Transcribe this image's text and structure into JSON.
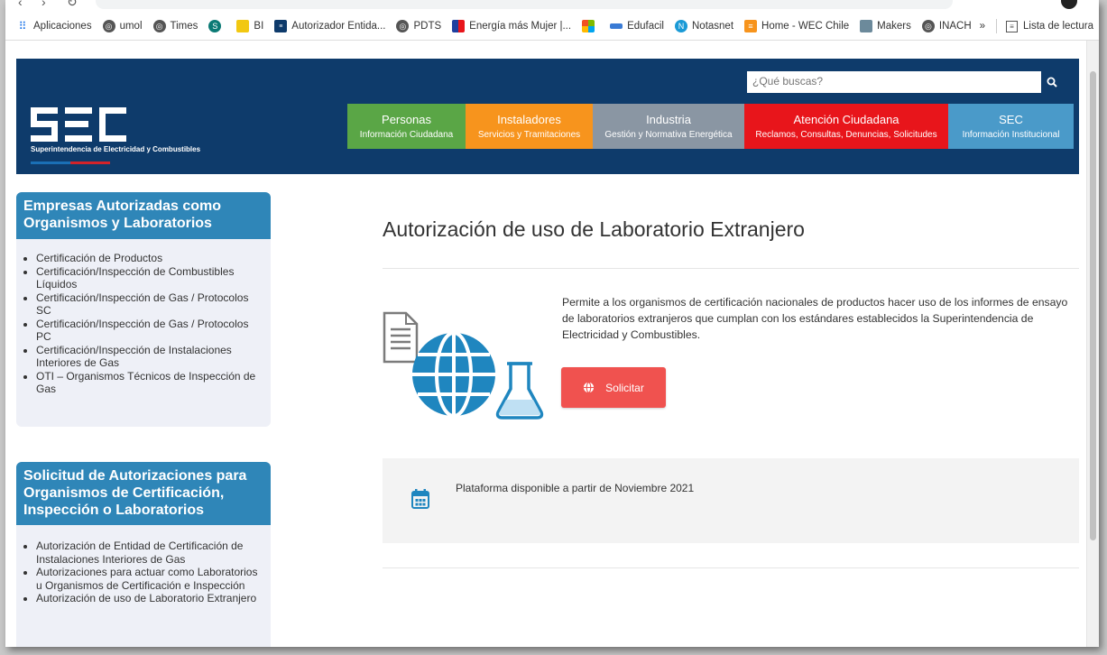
{
  "bookmarks": {
    "apps": "Aplicaciones",
    "items": [
      "umol",
      "Times",
      "BI",
      "Autorizador Entida...",
      "PDTS",
      "Energía más Mujer |...",
      "Edufacil",
      "Notasnet",
      "Home - WEC Chile",
      "Makers",
      "INACH"
    ],
    "more": "»",
    "reading_list": "Lista de lectura"
  },
  "header": {
    "logo_text": "SEC",
    "logo_subtitle": "Superintendencia de Electricidad y Combustibles",
    "search_placeholder": "¿Qué buscas?"
  },
  "menu": [
    {
      "title": "Personas",
      "subtitle": "Información Ciudadana",
      "color": "#5aa646"
    },
    {
      "title": "Instaladores",
      "subtitle": "Servicios y Tramitaciones",
      "color": "#f7941d"
    },
    {
      "title": "Industria",
      "subtitle": "Gestión y Normativa Energética",
      "color": "#8a96a3"
    },
    {
      "title": "Atención Ciudadana",
      "subtitle": "Reclamos, Consultas, Denuncias, Solicitudes",
      "color": "#e8151b"
    },
    {
      "title": "SEC",
      "subtitle": "Información Institucional",
      "color": "#4a9ac9"
    }
  ],
  "sidebar1": {
    "title": "Empresas Autorizadas como Organismos y Laboratorios",
    "items": [
      "Certificación de Productos",
      "Certificación/Inspección de Combustibles Líquidos",
      "Certificación/Inspección de Gas / Protocolos SC",
      "Certificación/Inspección de Gas / Protocolos PC",
      "Certificación/Inspección de Instalaciones Interiores de Gas",
      "OTI – Organismos Técnicos de Inspección de Gas"
    ]
  },
  "sidebar2": {
    "title": "Solicitud de Autorizaciones para Organismos de Certificación, Inspección o Laboratorios",
    "items": [
      "Autorización de Entidad de Certificación de Instalaciones Interiores de Gas",
      "Autorizaciones para actuar como Laboratorios u Organismos de Certificación e Inspección",
      "Autorización de uso de Laboratorio Extranjero"
    ]
  },
  "main": {
    "title": "Autorización de uso de Laboratorio Extranjero",
    "description": "Permite a los organismos de certificación nacionales de productos hacer uso de los informes de ensayo de laboratorios extranjeros que cumplan con los estándares establecidos la Superintendencia de Electricidad y Combustibles.",
    "button_label": "Solicitar",
    "availability": "Plataforma disponible a partir de  Noviembre 2021"
  },
  "colors": {
    "header_bg": "#0e3b6b",
    "sidebar_head": "#2f86b8",
    "button": "#f0524f",
    "icon_blue": "#1f86bf"
  }
}
